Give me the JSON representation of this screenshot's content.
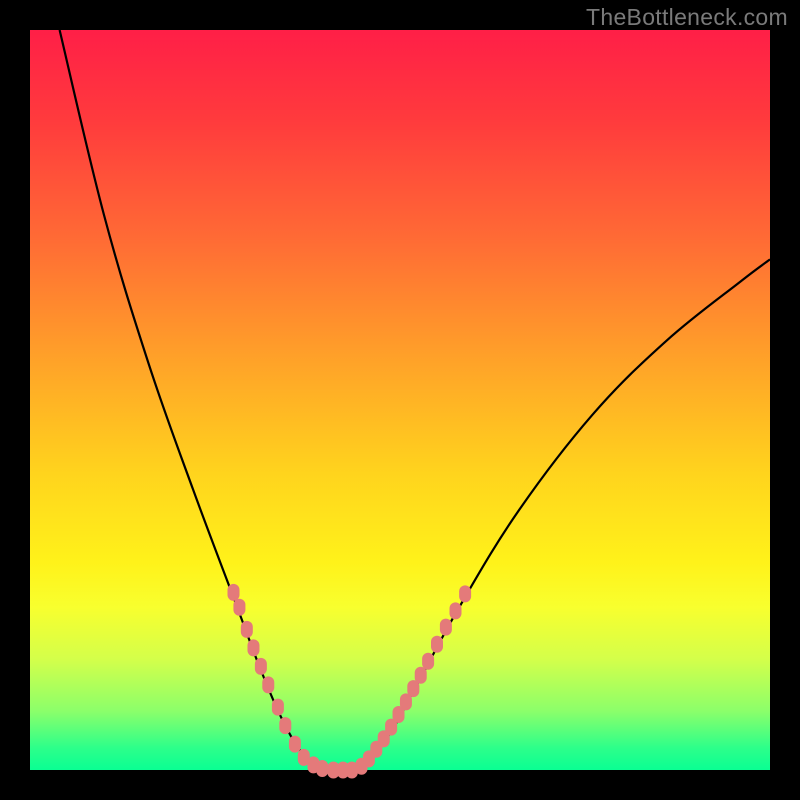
{
  "watermark": "TheBottleneck.com",
  "chart_data": {
    "type": "line",
    "title": "",
    "xlabel": "",
    "ylabel": "",
    "xlim": [
      0,
      100
    ],
    "ylim": [
      0,
      100
    ],
    "gradient_stops": [
      {
        "pos": 0,
        "color": "#ff1f47"
      },
      {
        "pos": 12,
        "color": "#ff3a3d"
      },
      {
        "pos": 28,
        "color": "#ff6a35"
      },
      {
        "pos": 44,
        "color": "#ffa029"
      },
      {
        "pos": 60,
        "color": "#ffd41d"
      },
      {
        "pos": 72,
        "color": "#fff21a"
      },
      {
        "pos": 78,
        "color": "#f8ff2e"
      },
      {
        "pos": 85,
        "color": "#d4ff4a"
      },
      {
        "pos": 92,
        "color": "#8cff6a"
      },
      {
        "pos": 97,
        "color": "#2dff8a"
      },
      {
        "pos": 100,
        "color": "#0aff93"
      }
    ],
    "series": [
      {
        "name": "left-curve",
        "points": [
          {
            "x": 4,
            "y": 100
          },
          {
            "x": 10,
            "y": 75
          },
          {
            "x": 16,
            "y": 55
          },
          {
            "x": 22,
            "y": 38
          },
          {
            "x": 28,
            "y": 22
          },
          {
            "x": 31,
            "y": 14
          },
          {
            "x": 34,
            "y": 7
          },
          {
            "x": 37,
            "y": 2
          },
          {
            "x": 40,
            "y": 0
          }
        ]
      },
      {
        "name": "right-curve",
        "points": [
          {
            "x": 44,
            "y": 0
          },
          {
            "x": 48,
            "y": 4
          },
          {
            "x": 52,
            "y": 11
          },
          {
            "x": 58,
            "y": 22
          },
          {
            "x": 66,
            "y": 35
          },
          {
            "x": 76,
            "y": 48
          },
          {
            "x": 86,
            "y": 58
          },
          {
            "x": 96,
            "y": 66
          },
          {
            "x": 100,
            "y": 69
          }
        ]
      },
      {
        "name": "flat-bottom",
        "points": [
          {
            "x": 40,
            "y": 0
          },
          {
            "x": 44,
            "y": 0
          }
        ]
      }
    ],
    "highlight_dots": {
      "left": [
        {
          "x": 27.5,
          "y": 24
        },
        {
          "x": 28.3,
          "y": 22
        },
        {
          "x": 29.3,
          "y": 19
        },
        {
          "x": 30.2,
          "y": 16.5
        },
        {
          "x": 31.2,
          "y": 14
        },
        {
          "x": 32.2,
          "y": 11.5
        },
        {
          "x": 33.5,
          "y": 8.5
        },
        {
          "x": 34.5,
          "y": 6
        },
        {
          "x": 35.8,
          "y": 3.5
        },
        {
          "x": 37.0,
          "y": 1.7
        },
        {
          "x": 38.3,
          "y": 0.7
        },
        {
          "x": 39.5,
          "y": 0.2
        },
        {
          "x": 41.0,
          "y": 0
        },
        {
          "x": 42.3,
          "y": 0
        },
        {
          "x": 43.5,
          "y": 0
        }
      ],
      "right": [
        {
          "x": 44.8,
          "y": 0.5
        },
        {
          "x": 45.8,
          "y": 1.5
        },
        {
          "x": 46.8,
          "y": 2.8
        },
        {
          "x": 47.8,
          "y": 4.2
        },
        {
          "x": 48.8,
          "y": 5.8
        },
        {
          "x": 49.8,
          "y": 7.5
        },
        {
          "x": 50.8,
          "y": 9.2
        },
        {
          "x": 51.8,
          "y": 11
        },
        {
          "x": 52.8,
          "y": 12.8
        },
        {
          "x": 53.8,
          "y": 14.7
        },
        {
          "x": 55.0,
          "y": 17
        },
        {
          "x": 56.2,
          "y": 19.3
        },
        {
          "x": 57.5,
          "y": 21.5
        },
        {
          "x": 58.8,
          "y": 23.8
        }
      ]
    }
  }
}
